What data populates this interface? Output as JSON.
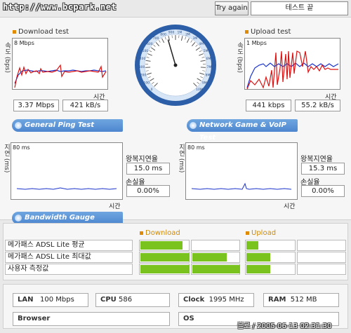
{
  "header": {
    "url": "http://www.bcpark.net",
    "try_again": "Try again",
    "status": "테스트 끝"
  },
  "download": {
    "title": "Download test",
    "ylabel": "속도 (bps)",
    "scale": "8 Mbps",
    "xlabel": "시간",
    "mbps": "3.37 Mbps",
    "kbs": "421 kB/s"
  },
  "upload": {
    "title": "Upload test",
    "ylabel": "속도 (bps)",
    "scale": "1 Mbps",
    "xlabel": "시간",
    "kbps": "441 kbps",
    "kbs": "55.2 kB/s"
  },
  "gauge": {
    "ticks": [
      "0",
      "100",
      "200",
      "300",
      "400",
      "500",
      "600",
      "700",
      "800",
      "900",
      "1M",
      "2M",
      "3M",
      "4M",
      "5M",
      "6M",
      "7M",
      "8M",
      "9M",
      "10M"
    ],
    "needle_ratio": 0.44
  },
  "tabs": {
    "ping": "General Ping Test",
    "game": "Network Game & VoIP Test",
    "bandwidth": "Bandwidth Gauge"
  },
  "ping_left": {
    "ylabel": "지연 (ms)",
    "scale": "80 ms",
    "xlabel": "시간",
    "rtt_label": "왕복지연율",
    "rtt": "15.0 ms",
    "loss_label": "손실율",
    "loss": "0.00%"
  },
  "ping_right": {
    "ylabel": "지연 (ms)",
    "scale": "80 ms",
    "xlabel": "시간",
    "rtt_label": "왕복지연율",
    "rtt": "15.3 ms",
    "loss_label": "손실율",
    "loss": "0.00%"
  },
  "bandwidth": {
    "download_label": "Download",
    "upload_label": "Upload",
    "rows": [
      {
        "label": "메가패스 ADSL Lite 평균",
        "down": 0.42,
        "up": 0.12
      },
      {
        "label": "메가패스 ADSL Lite 최대값",
        "down": 0.84,
        "up": 0.24
      },
      {
        "label": "사용자 측정값",
        "down": 1.0,
        "up": 0.24
      }
    ]
  },
  "system": {
    "lan_label": "LAN",
    "lan": "100 Mbps",
    "cpu_label": "CPU",
    "cpu": "586",
    "clock_label": "Clock",
    "clock": "1995 MHz",
    "ram_label": "RAM",
    "ram": "512 MB",
    "browser_label": "Browser",
    "browser": "",
    "os_label": "OS",
    "os": ""
  },
  "footer": "블로 / 2005-06-13 02:31:30"
}
